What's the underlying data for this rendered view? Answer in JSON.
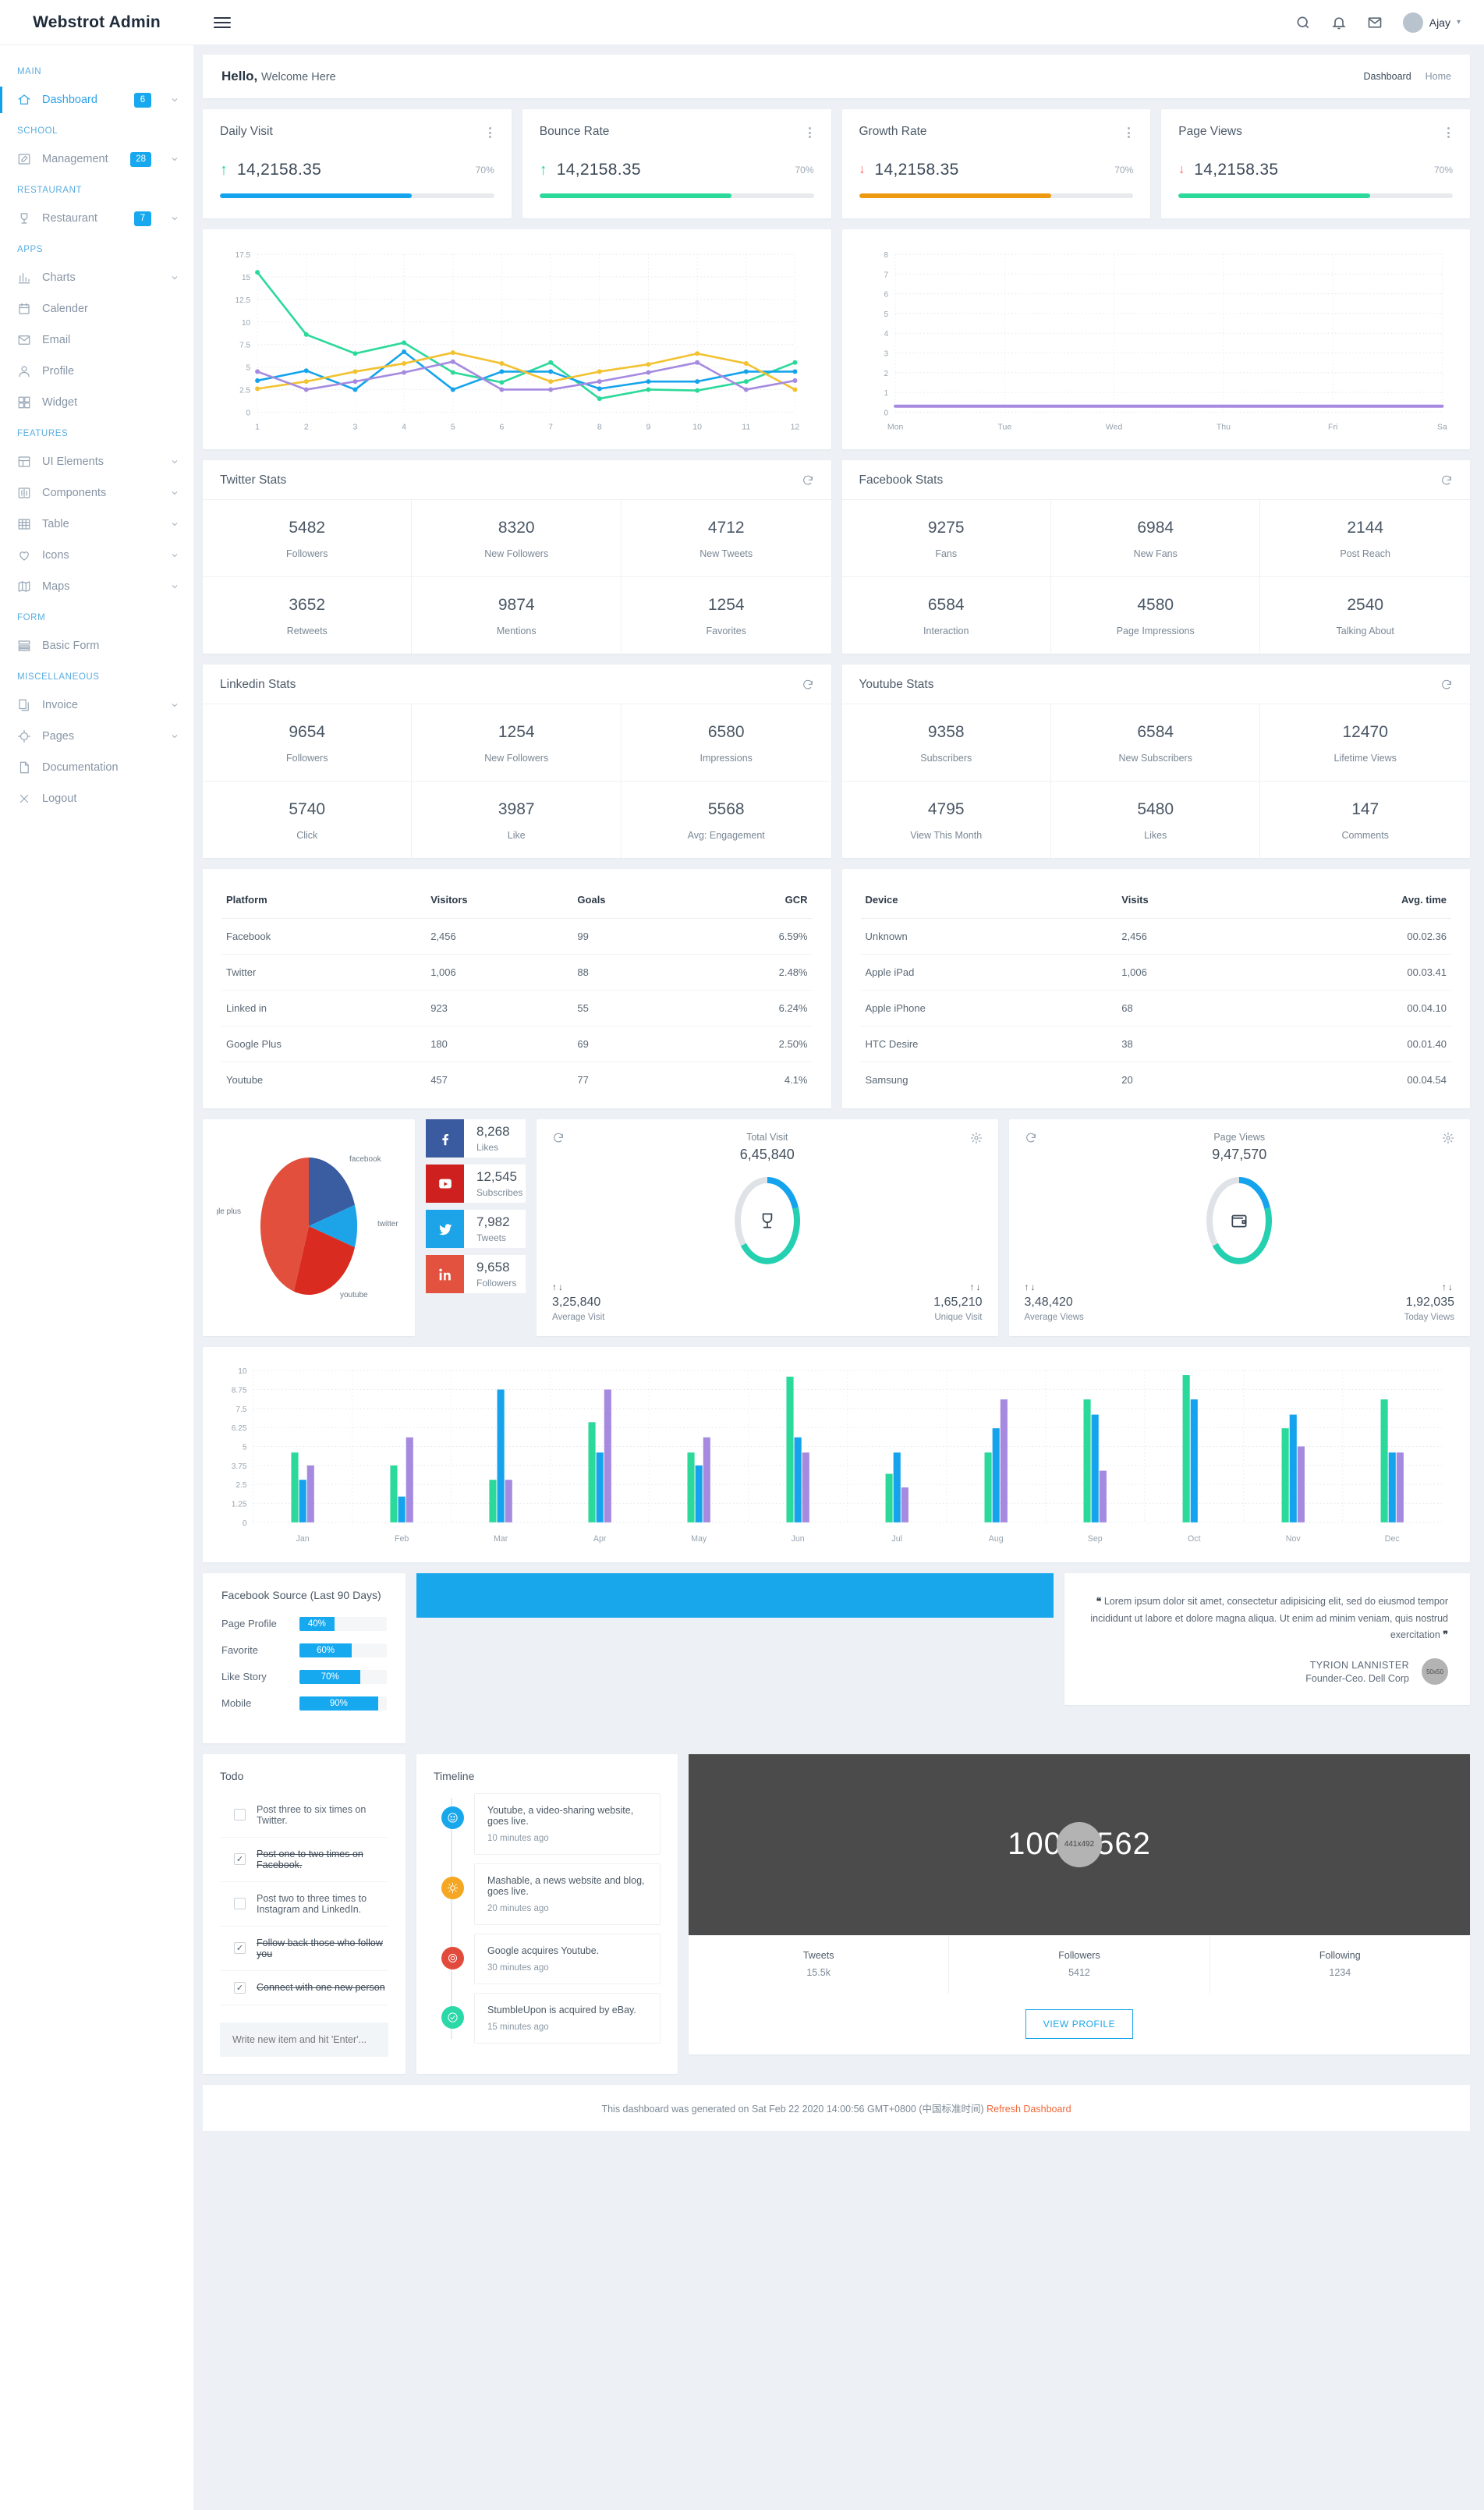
{
  "brand": "Webstrot Admin",
  "topbar": {
    "user_name": "Ajay",
    "icons": [
      "search-icon",
      "bell-icon",
      "mail-icon"
    ]
  },
  "sidebar": {
    "sections": [
      {
        "title": "MAIN",
        "items": [
          {
            "label": "Dashboard",
            "icon": "home-icon",
            "badge": "6",
            "chevron": true,
            "active": true
          }
        ]
      },
      {
        "title": "SCHOOL",
        "items": [
          {
            "label": "Management",
            "icon": "edit-icon",
            "badge": "28",
            "chevron": true,
            "active": false
          }
        ]
      },
      {
        "title": "RESTAURANT",
        "items": [
          {
            "label": "Restaurant",
            "icon": "trophy-icon",
            "badge": "7",
            "chevron": true,
            "active": false
          }
        ]
      },
      {
        "title": "APPS",
        "items": [
          {
            "label": "Charts",
            "icon": "bar-chart-icon",
            "badge": "",
            "chevron": true,
            "active": false
          },
          {
            "label": "Calender",
            "icon": "calendar-icon",
            "badge": "",
            "chevron": false,
            "active": false
          },
          {
            "label": "Email",
            "icon": "mail-icon",
            "badge": "",
            "chevron": false,
            "active": false
          },
          {
            "label": "Profile",
            "icon": "user-icon",
            "badge": "",
            "chevron": false,
            "active": false
          },
          {
            "label": "Widget",
            "icon": "grid-icon",
            "badge": "",
            "chevron": false,
            "active": false
          }
        ]
      },
      {
        "title": "FEATURES",
        "items": [
          {
            "label": "UI Elements",
            "icon": "layout-icon",
            "badge": "",
            "chevron": true,
            "active": false
          },
          {
            "label": "Components",
            "icon": "sliders-icon",
            "badge": "",
            "chevron": true,
            "active": false
          },
          {
            "label": "Table",
            "icon": "table-icon",
            "badge": "",
            "chevron": true,
            "active": false
          },
          {
            "label": "Icons",
            "icon": "heart-icon",
            "badge": "",
            "chevron": true,
            "active": false
          },
          {
            "label": "Maps",
            "icon": "map-icon",
            "badge": "",
            "chevron": true,
            "active": false
          }
        ]
      },
      {
        "title": "FORM",
        "items": [
          {
            "label": "Basic Form",
            "icon": "form-icon",
            "badge": "",
            "chevron": false,
            "active": false
          }
        ]
      },
      {
        "title": "MISCELLANEOUS",
        "items": [
          {
            "label": "Invoice",
            "icon": "copy-icon",
            "badge": "",
            "chevron": true,
            "active": false
          },
          {
            "label": "Pages",
            "icon": "target-icon",
            "badge": "",
            "chevron": true,
            "active": false
          },
          {
            "label": "Documentation",
            "icon": "file-icon",
            "badge": "",
            "chevron": false,
            "active": false
          },
          {
            "label": "Logout",
            "icon": "close-icon",
            "badge": "",
            "chevron": false,
            "active": false
          }
        ]
      }
    ]
  },
  "welcome": {
    "greeting": "Hello,",
    "subtitle": "Welcome Here",
    "crumb1": "Dashboard",
    "crumb2": "Home"
  },
  "stat_cards": [
    {
      "title": "Daily Visit",
      "value": "14,2158.35",
      "pct": "70%",
      "dir": "up",
      "color": "#14a3ec",
      "fill": 70
    },
    {
      "title": "Bounce Rate",
      "value": "14,2158.35",
      "pct": "70%",
      "dir": "up",
      "color": "#2bd99a",
      "fill": 70
    },
    {
      "title": "Growth Rate",
      "value": "14,2158.35",
      "pct": "70%",
      "dir": "down",
      "color": "#ee9a11",
      "fill": 70
    },
    {
      "title": "Page Views",
      "value": "14,2158.35",
      "pct": "70%",
      "dir": "down",
      "color": "#2bd99a",
      "fill": 70
    }
  ],
  "chart_data": [
    {
      "type": "line",
      "title": "",
      "x": [
        1,
        2,
        3,
        4,
        5,
        6,
        7,
        8,
        9,
        10,
        11,
        12
      ],
      "xlabel": "",
      "ylabel": "",
      "ylim": [
        0,
        17.5
      ],
      "yticks": [
        0,
        2.5,
        5,
        7.5,
        10,
        12.5,
        15,
        17.5
      ],
      "grid": true,
      "legend": "none",
      "series": [
        {
          "name": "green",
          "color": "#2bd99a",
          "values": [
            15.5,
            8.6,
            6.5,
            7.7,
            4.4,
            3.3,
            5.5,
            1.5,
            2.5,
            2.4,
            3.4,
            5.5
          ]
        },
        {
          "name": "blue",
          "color": "#14a3ec",
          "values": [
            3.5,
            4.6,
            2.5,
            6.7,
            2.5,
            4.5,
            4.5,
            2.6,
            3.4,
            3.4,
            4.5,
            4.5
          ]
        },
        {
          "name": "yellow",
          "color": "#f2c230",
          "values": [
            2.6,
            3.4,
            4.5,
            5.4,
            6.6,
            5.4,
            3.4,
            4.5,
            5.3,
            6.5,
            5.4,
            2.5
          ]
        },
        {
          "name": "purple",
          "color": "#a58ae0",
          "values": [
            4.5,
            2.5,
            3.4,
            4.4,
            5.6,
            2.5,
            2.5,
            3.4,
            4.4,
            5.5,
            2.5,
            3.5
          ]
        }
      ]
    },
    {
      "type": "line",
      "title": "",
      "x": [
        "Mon",
        "Tue",
        "Wed",
        "Thu",
        "Fri",
        "Sa"
      ],
      "xlabel": "",
      "ylabel": "",
      "ylim": [
        0,
        8
      ],
      "yticks": [
        0,
        1,
        2,
        3,
        4,
        5,
        6,
        7,
        8
      ],
      "grid": true,
      "legend": "none",
      "series": [
        {
          "name": "purple",
          "color": "#a58ae0",
          "values": [
            0.3,
            0.3,
            0.3,
            0.3,
            0.3,
            0.3
          ]
        }
      ]
    },
    {
      "type": "pie",
      "title": "",
      "labels": [
        "facebook",
        "twitter",
        "youtube",
        "google plus"
      ],
      "values": [
        20,
        10,
        25,
        45
      ],
      "colors": [
        "#3a5ca0",
        "#1da4e8",
        "#d92b20",
        "#e24f3c"
      ],
      "legend": "labels-around"
    },
    {
      "type": "bar",
      "title": "",
      "categories": [
        "Jan",
        "Feb",
        "Mar",
        "Apr",
        "May",
        "Jun",
        "Jul",
        "Aug",
        "Sep",
        "Oct",
        "Nov",
        "Dec"
      ],
      "ylim": [
        0,
        10
      ],
      "yticks": [
        0,
        1.25,
        2.5,
        3.75,
        5,
        6.25,
        7.5,
        8.75,
        10
      ],
      "grid": true,
      "legend": "none",
      "series": [
        {
          "name": "green",
          "color": "#2bd99a",
          "values": [
            4.6,
            3.75,
            2.8,
            6.6,
            4.6,
            9.6,
            3.2,
            4.6,
            8.1,
            9.7,
            6.2,
            8.1
          ]
        },
        {
          "name": "blue",
          "color": "#14a3ec",
          "values": [
            2.8,
            1.7,
            8.75,
            4.6,
            3.75,
            5.6,
            4.6,
            6.2,
            7.1,
            8.1,
            7.1,
            4.6
          ]
        },
        {
          "name": "purple",
          "color": "#a58ae0",
          "values": [
            3.75,
            5.6,
            2.8,
            8.75,
            5.6,
            4.6,
            2.3,
            8.1,
            3.4,
            0,
            5.0,
            4.6
          ]
        }
      ]
    },
    {
      "type": "donut",
      "title": "Total Visit",
      "value": "6,45,840",
      "segments": [
        {
          "name": "blue",
          "color": "#14a3ec",
          "pct": 20
        },
        {
          "name": "teal",
          "color": "#24d0b0",
          "pct": 45
        },
        {
          "name": "grey",
          "color": "#dfe3e7",
          "pct": 35
        }
      ]
    },
    {
      "type": "donut",
      "title": "Page Views",
      "value": "9,47,570",
      "segments": [
        {
          "name": "blue",
          "color": "#14a3ec",
          "pct": 20
        },
        {
          "name": "teal",
          "color": "#24d0b0",
          "pct": 45
        },
        {
          "name": "grey",
          "color": "#dfe3e7",
          "pct": 35
        }
      ]
    },
    {
      "type": "bar",
      "title": "Facebook Source (Last 90 Days)",
      "orientation": "horizontal",
      "categories": [
        "Page Profile",
        "Favorite",
        "Like Story",
        "Mobile"
      ],
      "values": [
        40,
        60,
        70,
        90
      ],
      "value_labels": [
        "40%",
        "60%",
        "70%",
        "90%"
      ],
      "color": "#16a9f0",
      "xlim": [
        0,
        100
      ]
    }
  ],
  "social_panels": [
    {
      "title": "Twitter Stats",
      "cells": [
        {
          "num": "5482",
          "label": "Followers"
        },
        {
          "num": "8320",
          "label": "New Followers"
        },
        {
          "num": "4712",
          "label": "New Tweets"
        },
        {
          "num": "3652",
          "label": "Retweets"
        },
        {
          "num": "9874",
          "label": "Mentions"
        },
        {
          "num": "1254",
          "label": "Favorites"
        }
      ]
    },
    {
      "title": "Facebook Stats",
      "cells": [
        {
          "num": "9275",
          "label": "Fans"
        },
        {
          "num": "6984",
          "label": "New Fans"
        },
        {
          "num": "2144",
          "label": "Post Reach"
        },
        {
          "num": "6584",
          "label": "Interaction"
        },
        {
          "num": "4580",
          "label": "Page Impressions"
        },
        {
          "num": "2540",
          "label": "Talking About"
        }
      ]
    },
    {
      "title": "Linkedin Stats",
      "cells": [
        {
          "num": "9654",
          "label": "Followers"
        },
        {
          "num": "1254",
          "label": "New Followers"
        },
        {
          "num": "6580",
          "label": "Impressions"
        },
        {
          "num": "5740",
          "label": "Click"
        },
        {
          "num": "3987",
          "label": "Like"
        },
        {
          "num": "5568",
          "label": "Avg: Engagement"
        }
      ]
    },
    {
      "title": "Youtube Stats",
      "cells": [
        {
          "num": "9358",
          "label": "Subscribers"
        },
        {
          "num": "6584",
          "label": "New Subscribers"
        },
        {
          "num": "12470",
          "label": "Lifetime Views"
        },
        {
          "num": "4795",
          "label": "View This Month"
        },
        {
          "num": "5480",
          "label": "Likes"
        },
        {
          "num": "147",
          "label": "Comments"
        }
      ]
    }
  ],
  "platform_table": {
    "headers": [
      "Platform",
      "Visitors",
      "Goals",
      "GCR"
    ],
    "rows": [
      [
        "Facebook",
        "2,456",
        "99",
        "6.59%"
      ],
      [
        "Twitter",
        "1,006",
        "88",
        "2.48%"
      ],
      [
        "Linked in",
        "923",
        "55",
        "6.24%"
      ],
      [
        "Google Plus",
        "180",
        "69",
        "2.50%"
      ],
      [
        "Youtube",
        "457",
        "77",
        "4.1%"
      ]
    ]
  },
  "device_table": {
    "headers": [
      "Device",
      "Visits",
      "Avg. time"
    ],
    "rows": [
      [
        "Unknown",
        "2,456",
        "00.02.36"
      ],
      [
        "Apple iPad",
        "1,006",
        "00.03.41"
      ],
      [
        "Apple iPhone",
        "68",
        "00.04.10"
      ],
      [
        "HTC Desire",
        "38",
        "00.01.40"
      ],
      [
        "Samsung",
        "20",
        "00.04.54"
      ]
    ]
  },
  "social_tiles": [
    {
      "icon": "facebook-icon",
      "num": "8,268",
      "label": "Likes",
      "color": "#3a5ba0"
    },
    {
      "icon": "youtube-icon",
      "num": "12,545",
      "label": "Subscribes",
      "color": "#cd201f"
    },
    {
      "icon": "twitter-icon",
      "num": "7,982",
      "label": "Tweets",
      "color": "#1da4e8"
    },
    {
      "icon": "linkedin-icon",
      "num": "9,658",
      "label": "Followers",
      "color": "#e2523f"
    }
  ],
  "donut_cards": [
    {
      "title": "Total Visit",
      "value": "6,45,840",
      "center_icon": "trophy-icon",
      "left_num": "3,25,840",
      "left_label": "Average Visit",
      "right_num": "1,65,210",
      "right_label": "Unique Visit",
      "arrows": "↑↓"
    },
    {
      "title": "Page Views",
      "value": "9,47,570",
      "center_icon": "wallet-icon",
      "left_num": "3,48,420",
      "left_label": "Average Views",
      "right_num": "1,92,035",
      "right_label": "Today Views",
      "arrows": "↑↓"
    }
  ],
  "facebook_source": {
    "title": "Facebook Source (Last 90 Days)",
    "rows": [
      {
        "label": "Page Profile",
        "pct": 40,
        "text": "40%"
      },
      {
        "label": "Favorite",
        "pct": 60,
        "text": "60%"
      },
      {
        "label": "Like Story",
        "pct": 70,
        "text": "70%"
      },
      {
        "label": "Mobile",
        "pct": 90,
        "text": "90%"
      }
    ]
  },
  "testimonial": {
    "text": "Lorem ipsum dolor sit amet, consectetur adipisicing elit, sed do eiusmod tempor incididunt ut labore et dolore magna aliqua. Ut enim ad minim veniam, quis nostrud exercitation",
    "name": "TYRION LANNISTER",
    "role": "Founder-Ceo. Dell Corp",
    "avatar_text": "50x50"
  },
  "todo": {
    "title": "Todo",
    "items": [
      {
        "text": "Post three to six times on Twitter.",
        "done": false
      },
      {
        "text": "Post one to two times on Facebook.",
        "done": true
      },
      {
        "text": "Post two to three times to Instagram and LinkedIn.",
        "done": false
      },
      {
        "text": "Follow back those who follow you",
        "done": true
      },
      {
        "text": "Connect with one new person",
        "done": true
      }
    ],
    "placeholder": "Write new item and hit 'Enter'..."
  },
  "timeline": {
    "title": "Timeline",
    "items": [
      {
        "text": "Youtube, a video-sharing website, goes live.",
        "time": "10 minutes ago",
        "color": "#19a7ec",
        "icon": "smiley-icon"
      },
      {
        "text": "Mashable, a news website and blog, goes live.",
        "time": "20 minutes ago",
        "color": "#f5a623",
        "icon": "sun-icon"
      },
      {
        "text": "Google acquires Youtube.",
        "time": "30 minutes ago",
        "color": "#e24b3c",
        "icon": "record-icon"
      },
      {
        "text": "StumbleUpon is acquired by eBay.",
        "time": "15 minutes ago",
        "color": "#2bd9a8",
        "icon": "check-circle-icon"
      }
    ]
  },
  "profile_card": {
    "image_dim": "1000x562",
    "badge_dim": "441x492",
    "stats": [
      {
        "label": "Tweets",
        "value": "15.5k"
      },
      {
        "label": "Followers",
        "value": "5412"
      },
      {
        "label": "Following",
        "value": "1234"
      }
    ],
    "button": "VIEW PROFILE"
  },
  "footer": {
    "text": "This dashboard was generated on Sat Feb 22 2020 14:00:56 GMT+0800 (中国标准时间)",
    "link": "Refresh Dashboard"
  }
}
